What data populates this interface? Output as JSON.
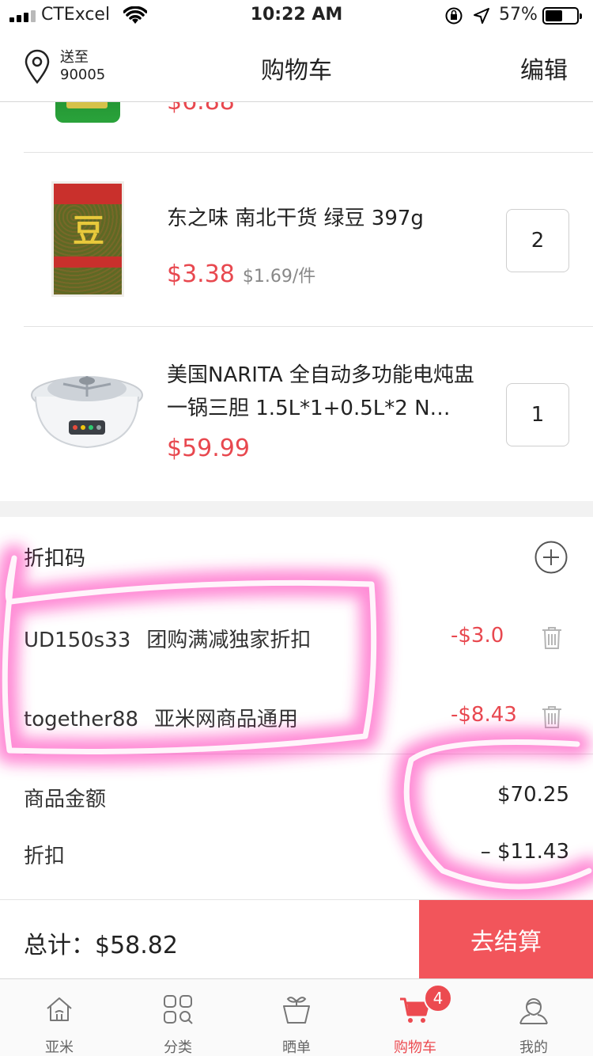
{
  "status": {
    "carrier": "CTExcel",
    "time": "10:22 AM",
    "battery": "57%",
    "battery_level": 0.57
  },
  "header": {
    "location_label": "送至",
    "location_zip": "90005",
    "title": "购物车",
    "edit": "编辑"
  },
  "cart": {
    "partial_price": "$6.88",
    "items": [
      {
        "name": "东之味 南北干货 绿豆 397g",
        "price": "$3.38",
        "unit_price": "$1.69/件",
        "qty": "2",
        "image": "mung-bean-bag",
        "image_text": "豆"
      },
      {
        "name": "美国NARITA 全自动多功能电炖盅 一锅三胆 1.5L*1+0.5L*2 N…",
        "price": "$59.99",
        "unit_price": "",
        "qty": "1",
        "image": "electric-stew-pot"
      }
    ]
  },
  "coupons": {
    "title": "折扣码",
    "list": [
      {
        "code": "UD150s33",
        "desc": "团购满减独家折扣",
        "amount": "-$3.0"
      },
      {
        "code": "together88",
        "desc": "亚米网商品通用",
        "amount": "-$8.43"
      }
    ]
  },
  "summary": {
    "subtotal_label": "商品金额",
    "subtotal": "$70.25",
    "discount_label": "折扣",
    "discount": "– $11.43"
  },
  "checkout": {
    "total": "总计：$58.82",
    "button": "去结算"
  },
  "tabs": [
    {
      "label": "亚米",
      "icon": "home-icon"
    },
    {
      "label": "分类",
      "icon": "category-icon"
    },
    {
      "label": "晒单",
      "icon": "plant-pot-icon"
    },
    {
      "label": "购物车",
      "icon": "cart-icon",
      "badge": "4",
      "active": true
    },
    {
      "label": "我的",
      "icon": "profile-icon"
    }
  ],
  "colors": {
    "accent": "#f2555b",
    "price": "#e8484f",
    "marker": "#ff2fb4"
  }
}
